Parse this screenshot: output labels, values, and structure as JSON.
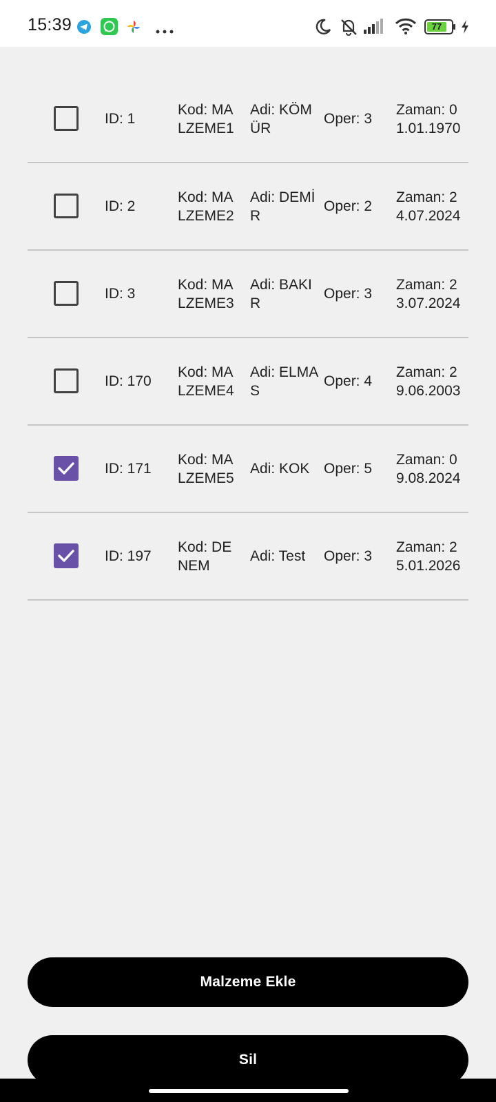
{
  "status_bar": {
    "time": "15:39",
    "battery": "77",
    "left_icons": [
      "telegram-icon",
      "whatsapp-icon",
      "photos-pinwheel-icon",
      "more-dots-icon"
    ],
    "right_icons": [
      "moon-icon",
      "bell-off-icon",
      "signal-icon",
      "wifi-icon",
      "battery-icon",
      "charging-bolt-icon"
    ]
  },
  "items": [
    {
      "checked": false,
      "id": "ID: 1",
      "kod": "Kod: MALZEME1",
      "adi": "Adi: KÖMÜR",
      "oper": "Oper: 3",
      "zaman": "Zaman: 01.01.1970"
    },
    {
      "checked": false,
      "id": "ID: 2",
      "kod": "Kod: MALZEME2",
      "adi": "Adi: DEMİR",
      "oper": "Oper: 2",
      "zaman": "Zaman: 24.07.2024"
    },
    {
      "checked": false,
      "id": "ID: 3",
      "kod": "Kod: MALZEME3",
      "adi": "Adi: BAKIR",
      "oper": "Oper: 3",
      "zaman": "Zaman: 23.07.2024"
    },
    {
      "checked": false,
      "id": "ID: 170",
      "kod": "Kod: MALZEME4",
      "adi": "Adi: ELMAS",
      "oper": "Oper: 4",
      "zaman": "Zaman: 29.06.2003"
    },
    {
      "checked": true,
      "id": "ID: 171",
      "kod": "Kod: MALZEME5",
      "adi": "Adi: KOK",
      "oper": "Oper: 5",
      "zaman": "Zaman: 09.08.2024"
    },
    {
      "checked": true,
      "id": "ID: 197",
      "kod": "Kod: DENEM",
      "adi": "Adi: Test",
      "oper": "Oper: 3",
      "zaman": "Zaman: 25.01.2026"
    }
  ],
  "buttons": {
    "add_label": "Malzeme Ekle",
    "delete_label": "Sil"
  },
  "colors": {
    "accent": "#6a51a8",
    "button_bg": "#000000",
    "background": "#f0f0f0"
  }
}
